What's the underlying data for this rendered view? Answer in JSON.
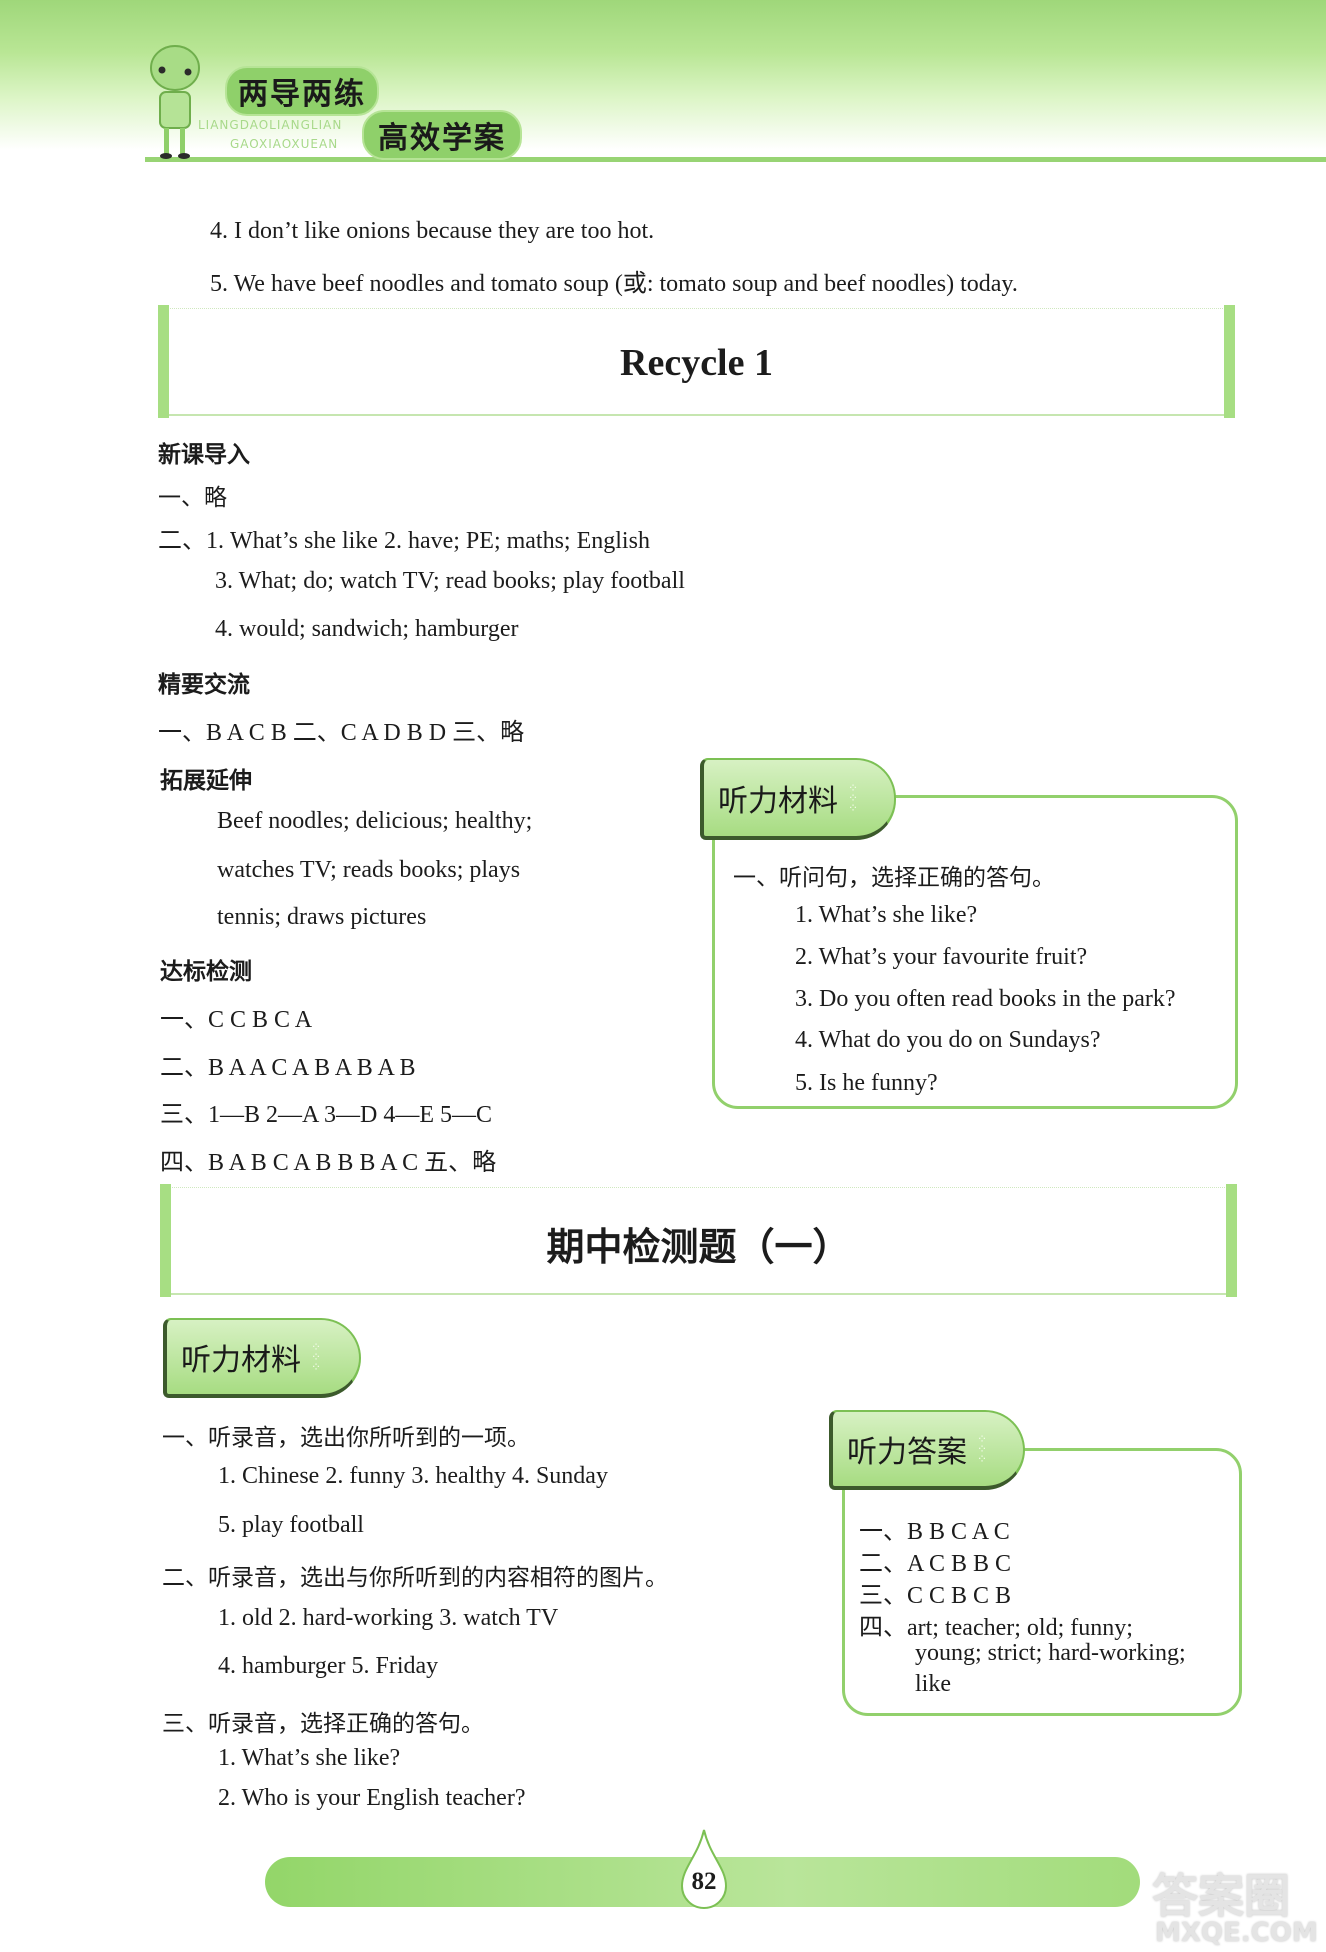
{
  "header": {
    "logo_title_1": "两导两练",
    "logo_title_2": "高效学案",
    "logo_pinyin_1": "LIANGDAOLIANGLIAN",
    "logo_pinyin_2": "GAOXIAOXUEAN"
  },
  "top_lines": [
    "4.  I don’t like onions because they are too hot.",
    "5.  We have beef noodles and tomato soup (或: tomato soup and beef noodles) today."
  ],
  "recycle": {
    "title": "Recycle 1",
    "xinke": {
      "heading": "新课导入",
      "lines": [
        "一、略",
        "二、1.  What’s she like    2.  have;  PE;  maths;  English",
        "3.  What;  do;  watch TV;  read books;  play football",
        "4.  would;  sandwich;  hamburger"
      ]
    },
    "jingyao": {
      "heading": "精要交流",
      "line": "一、B   A   C   B       二、C   A   D   B   D       三、略"
    },
    "tuozhan": {
      "heading": "拓展延伸",
      "lines": [
        "Beef noodles;  delicious;  healthy;",
        "watches TV;  reads books;  plays",
        "tennis;  draws pictures"
      ]
    },
    "dabiao": {
      "heading": "达标检测",
      "lines": [
        "一、C   C   B   C   A",
        "二、B   A   A   C   A       B   A   B   A   B",
        "三、1—B   2—A   3—D   4—E   5—C",
        "四、B   A   B   C   A       B   B   B   A   C       五、略"
      ]
    },
    "listening": {
      "tab_label": "听力材料",
      "instruction": "一、听问句，选择正确的答句。",
      "items": [
        "1. What’s she like?",
        "2. What’s your favourite fruit?",
        "3. Do you often read books in the park?",
        "4. What do you do on Sundays?",
        "5. Is he funny?"
      ]
    }
  },
  "midterm": {
    "title": "期中检测题（一）",
    "listening": {
      "tab_label": "听力材料",
      "sections": [
        {
          "instruction": "一、听录音，选出你所听到的一项。",
          "lines": [
            "1.  Chinese   2.  funny   3.  healthy   4.  Sunday",
            "5.  play football"
          ]
        },
        {
          "instruction": "二、听录音，选出与你所听到的内容相符的图片。",
          "lines": [
            "1.  old   2.  hard-working   3.  watch TV",
            "4.  hamburger   5.  Friday"
          ]
        },
        {
          "instruction": "三、听录音，选择正确的答句。",
          "lines": [
            "1.  What’s she like?",
            "2.  Who is your English teacher?"
          ]
        }
      ]
    },
    "answers": {
      "tab_label": "听力答案",
      "lines": [
        "一、B  B  C  A  C",
        "二、A  C  B  B  C",
        "三、C  C  B  C  B",
        "四、art; teacher; old; funny;",
        "young; strict; hard-working;",
        "like"
      ]
    }
  },
  "footer": {
    "page_number": "82",
    "watermark_1": "答案圈",
    "watermark_2": "MXQE.COM"
  },
  "colors": {
    "accent_green": "#92d06c",
    "light_green": "#c6ebac",
    "text": "#1c1c1c"
  }
}
